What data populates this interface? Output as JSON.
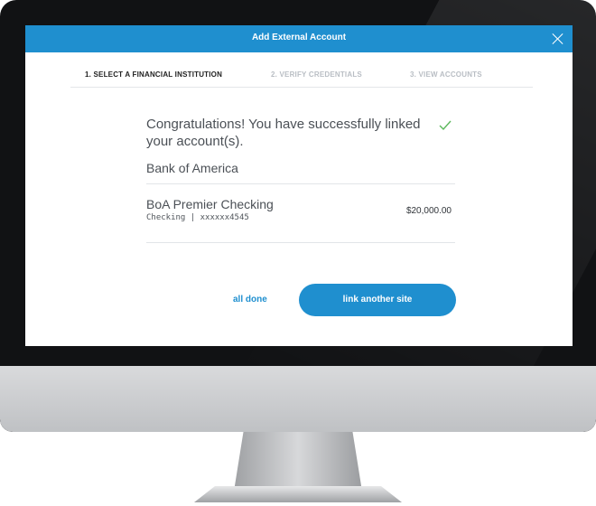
{
  "window": {
    "title": "Add External Account"
  },
  "steps": [
    {
      "label": "1. SELECT A FINANCIAL INSTITUTION",
      "state": "active"
    },
    {
      "label": "2. VERIFY CREDENTIALS",
      "state": "inactive"
    },
    {
      "label": "3. VIEW ACCOUNTS",
      "state": "inactive"
    }
  ],
  "content": {
    "message": "Congratulations! You have successfully linked your account(s).",
    "institution": "Bank of America",
    "account": {
      "name": "BoA Premier Checking",
      "details": "Checking | xxxxxx4545",
      "balance": "$20,000.00"
    }
  },
  "actions": {
    "all_done": "all done",
    "link_another": "link another site"
  },
  "colors": {
    "accent": "#1f8fcf",
    "check": "#5cb85c"
  },
  "icons": {
    "close": "close-icon",
    "success": "check-icon"
  }
}
